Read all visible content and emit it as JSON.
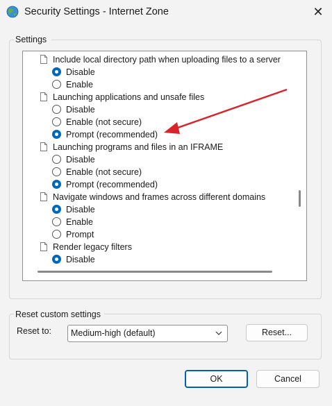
{
  "window": {
    "title": "Security Settings - Internet Zone",
    "icon": "globe-icon",
    "close_glyph": "✕"
  },
  "settings": {
    "group_label": "Settings",
    "items": [
      {
        "type": "heading",
        "label": "Include local directory path when uploading files to a server"
      },
      {
        "type": "option",
        "label": "Disable",
        "checked": true
      },
      {
        "type": "option",
        "label": "Enable",
        "checked": false
      },
      {
        "type": "heading",
        "label": "Launching applications and unsafe files"
      },
      {
        "type": "option",
        "label": "Disable",
        "checked": false
      },
      {
        "type": "option",
        "label": "Enable (not secure)",
        "checked": false
      },
      {
        "type": "option",
        "label": "Prompt (recommended)",
        "checked": true
      },
      {
        "type": "heading",
        "label": "Launching programs and files in an IFRAME"
      },
      {
        "type": "option",
        "label": "Disable",
        "checked": false
      },
      {
        "type": "option",
        "label": "Enable (not secure)",
        "checked": false
      },
      {
        "type": "option",
        "label": "Prompt (recommended)",
        "checked": true
      },
      {
        "type": "heading",
        "label": "Navigate windows and frames across different domains"
      },
      {
        "type": "option",
        "label": "Disable",
        "checked": true
      },
      {
        "type": "option",
        "label": "Enable",
        "checked": false
      },
      {
        "type": "option",
        "label": "Prompt",
        "checked": false
      },
      {
        "type": "heading",
        "label": "Render legacy filters"
      },
      {
        "type": "option",
        "label": "Disable",
        "checked": true
      }
    ]
  },
  "reset": {
    "group_label": "Reset custom settings",
    "reset_to_label": "Reset to:",
    "selected_level": "Medium-high (default)",
    "reset_button": "Reset..."
  },
  "footer": {
    "ok_label": "OK",
    "cancel_label": "Cancel"
  },
  "colors": {
    "accent": "#0067c0",
    "annotation_arrow": "#d9252a"
  }
}
